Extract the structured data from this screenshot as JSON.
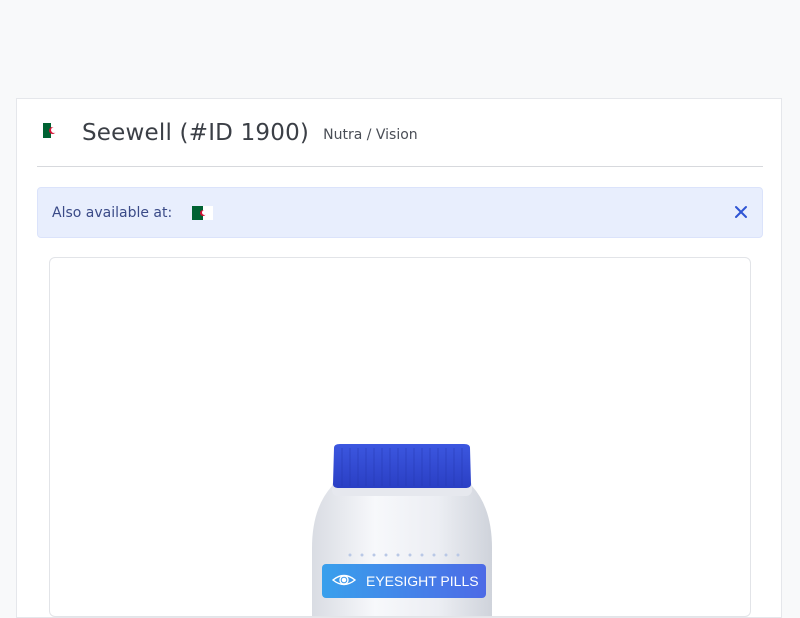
{
  "header": {
    "country_flag": "algeria-flag-icon",
    "title": "Seewell (#ID 1900)",
    "category": "Nutra / Vision"
  },
  "alert": {
    "text": "Also available at:",
    "flag": "algeria-flag-icon",
    "close_icon": "close-icon"
  },
  "product": {
    "label": "EYESIGHT PILLS",
    "cap_color": "#2f4bd6",
    "label_color": "#3a7de8"
  },
  "colors": {
    "page_bg": "#f8f9fa",
    "alert_bg": "#e8eefd",
    "alert_text": "#3a4a87",
    "flag_green": "#006233",
    "flag_red": "#d21034"
  }
}
